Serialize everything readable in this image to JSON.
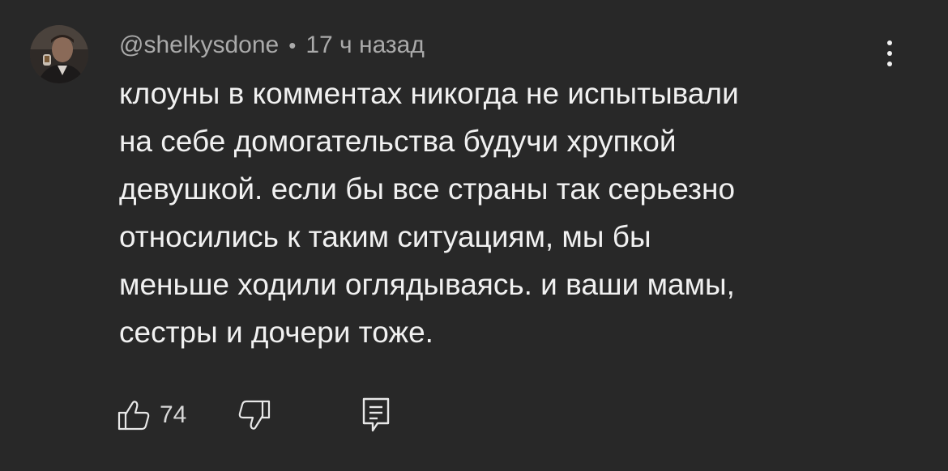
{
  "comment": {
    "author": "@shelkysdone",
    "separator": "•",
    "time": "17 ч назад",
    "text": "клоуны в комментах никогда не испытывали\nна себе домогательства будучи хрупкой\nдевушкой. если бы все страны так серьезно\nотносились к таким ситуациям, мы бы\nменьше ходили оглядываясь. и ваши мамы,\nсестры и дочери тоже.",
    "likes": "74"
  },
  "icons": {
    "like": "thumbs-up-icon",
    "dislike": "thumbs-down-icon",
    "reply": "comment-reply-icon",
    "menu": "more-vertical-icon"
  },
  "colors": {
    "background": "#282828",
    "text": "#f1f1f1",
    "meta": "#aaaaaa"
  }
}
